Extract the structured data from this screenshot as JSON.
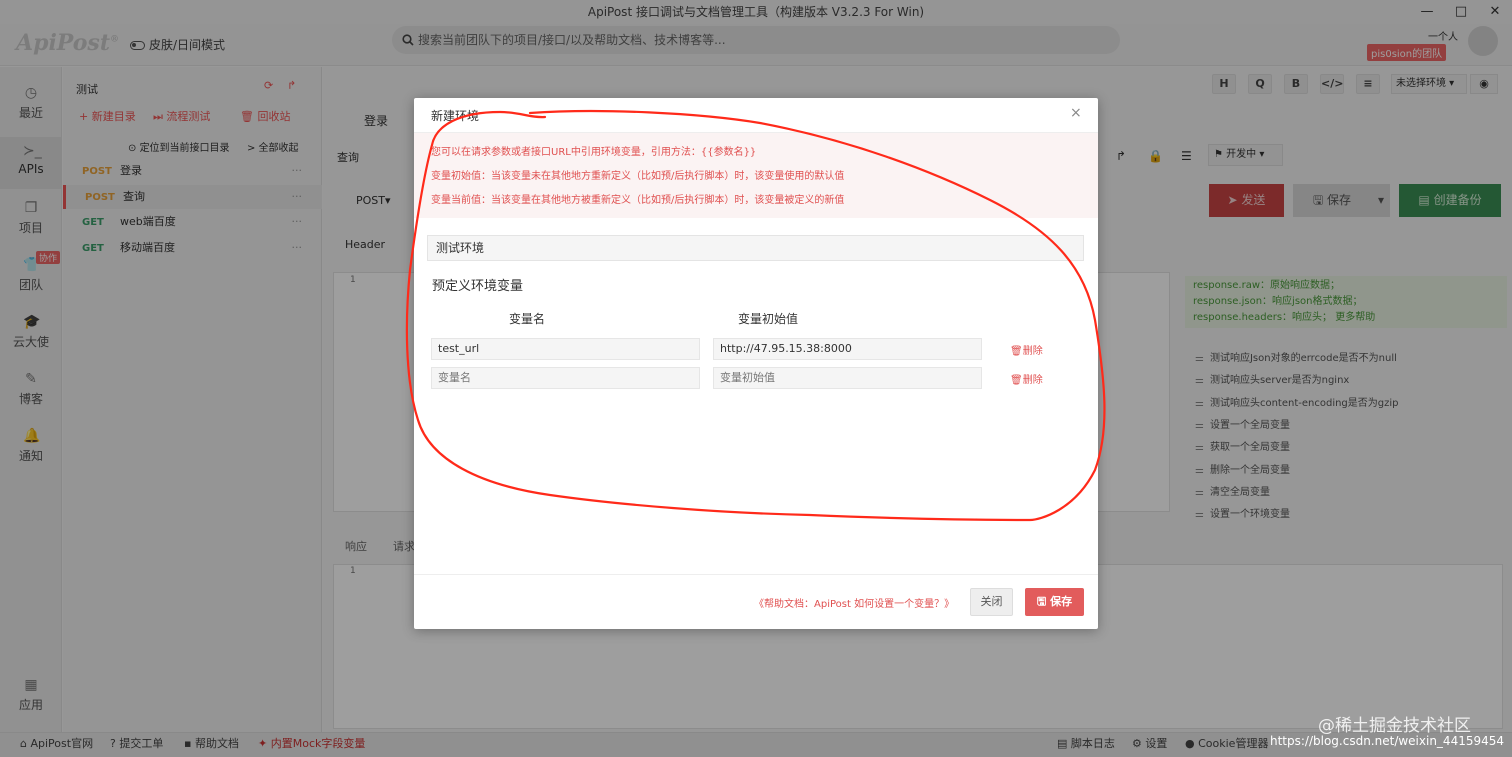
{
  "window": {
    "title": "ApiPost 接口调试与文档管理工具（构建版本 V3.2.3 For Win)",
    "minimize": "—",
    "maximize": "□",
    "close": "✕"
  },
  "header": {
    "logo": "ApiPost",
    "logo_mark": "®",
    "skin_toggle": "皮肤/日间模式",
    "search_placeholder": "搜索当前团队下的项目/接口/以及帮助文档、技术博客等...",
    "username": "一个人",
    "team": "pis0sion的团队"
  },
  "leftnav": [
    {
      "label": "最近",
      "icon": "clock-icon"
    },
    {
      "label": "APIs",
      "icon": "terminal-icon"
    },
    {
      "label": "项目",
      "icon": "project-icon"
    },
    {
      "label": "团队",
      "icon": "team-icon",
      "badge": "协作"
    },
    {
      "label": "云大使",
      "icon": "graduation-icon"
    },
    {
      "label": "博客",
      "icon": "edit-icon"
    },
    {
      "label": "通知",
      "icon": "bell-icon"
    },
    {
      "label": "应用",
      "icon": "grid-icon"
    }
  ],
  "tree": {
    "project": "测试",
    "new_dir": "+ 新建目录",
    "flow_test": "⏭ 流程测试",
    "recycle": "🗑 回收站",
    "locate": "定位到当前接口目录",
    "collapse": "> 全部收起",
    "items": [
      {
        "method": "POST",
        "name": "登录"
      },
      {
        "method": "POST",
        "name": "查询"
      },
      {
        "method": "GET",
        "name": "web端百度"
      },
      {
        "method": "GET",
        "name": "移动端百度"
      }
    ]
  },
  "main": {
    "tab_login": "登录",
    "tab_query": "查询",
    "method": "POST▾",
    "header_tab": "Header",
    "resp_tab": "响应",
    "req_tab": "请求",
    "line1": "1",
    "toolbar": [
      "H",
      "Q",
      "B",
      "</>",
      "≡"
    ],
    "env_select": "未选择环境 ▾",
    "dev_status": "开发中 ▾",
    "send": "发送",
    "save": "保存",
    "backup": "创建备份",
    "help_lines": [
      "response.raw：原始响应数据；",
      "response.json：响应json格式数据；",
      "response.headers：响应头；  更多帮助"
    ],
    "snippets": [
      "测试响应Json对象的errcode是否不为null",
      "测试响应头server是否为nginx",
      "测试响应头content-encoding是否为gzip",
      "设置一个全局变量",
      "获取一个全局变量",
      "删除一个全局变量",
      "清空全局变量",
      "设置一个环境变量"
    ]
  },
  "footer": {
    "site": "ApiPost官网",
    "ticket": "提交工单",
    "docs": "帮助文档",
    "mock": "内置Mock字段变量",
    "log": "脚本日志",
    "settings": "设置",
    "cookie": "Cookie管理器",
    "watermark": "https://blog.csdn.net/weixin_44159454",
    "watermark2": "@稀土掘金技术社区"
  },
  "modal": {
    "title": "新建环境",
    "close": "×",
    "notice": [
      "您可以在请求参数或者接口URL中引用环境变量，引用方法：{{参数名}}",
      "变量初始值：当该变量未在其他地方重新定义（比如预/后执行脚本）时，该变量使用的默认值",
      "变量当前值：当该变量在其他地方被重新定义（比如预/后执行脚本）时，该变量被定义的新值"
    ],
    "env_name": "测试环境",
    "section_title": "预定义环境变量",
    "col_name": "变量名",
    "col_init": "变量初始值",
    "rows": [
      {
        "name": "test_url",
        "init": "http://47.95.15.38:8000"
      },
      {
        "name_placeholder": "变量名",
        "init_placeholder": "变量初始值"
      }
    ],
    "delete": "删除",
    "help_link": "《帮助文档：ApiPost 如何设置一个变量？》",
    "close_btn": "关闭",
    "save_btn": "保存"
  },
  "colors": {
    "accent_red": "#e25c5c",
    "annotation_red": "#ff2a1a",
    "post": "#e8a23b",
    "get": "#3c9f6b"
  }
}
